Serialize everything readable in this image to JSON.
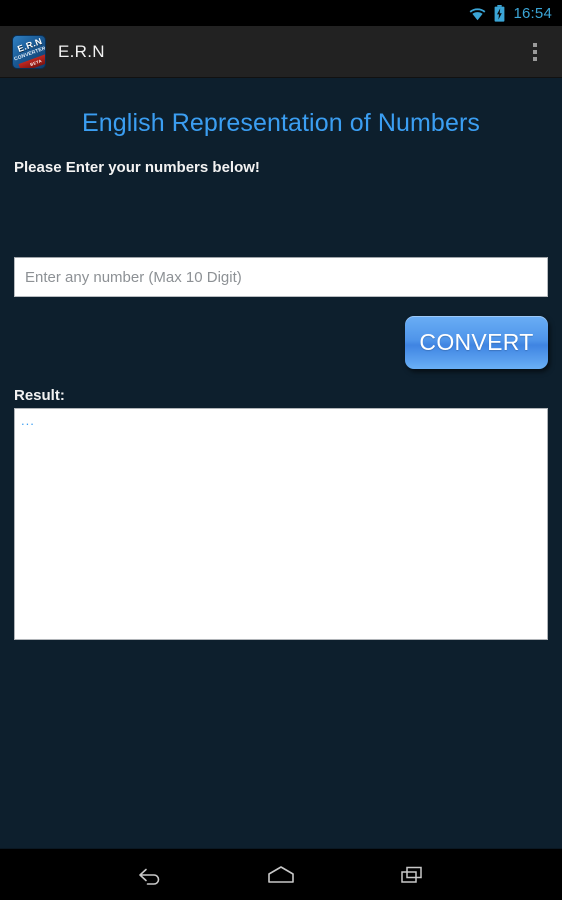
{
  "status_bar": {
    "time": "16:54",
    "icons": [
      "wifi-icon",
      "battery-charging-icon"
    ],
    "accent_color": "#3ba5d6",
    "background": "#000000"
  },
  "action_bar": {
    "app_title": "E.R.N",
    "app_icon": {
      "name": "ern-converter-app-icon",
      "primary_text": "E.R.N",
      "secondary_text": "CONVERTER",
      "ribbon_text": "BETA"
    },
    "overflow_menu_label": "More options",
    "background": "#222222"
  },
  "screen": {
    "title": "English Representation of Numbers",
    "title_color": "#3b9ef2",
    "subtitle": "Please Enter your numbers below!",
    "background": "#0d1f2d"
  },
  "input": {
    "placeholder": "Enter any number (Max 10 Digit)",
    "value": ""
  },
  "convert_button": {
    "label": "CONVERT",
    "color": "#4f95ea"
  },
  "result": {
    "label": "Result:",
    "value": "...",
    "text_color": "#3b9ef2"
  },
  "nav_bar": {
    "buttons": [
      {
        "name": "back",
        "label": "Back"
      },
      {
        "name": "home",
        "label": "Home"
      },
      {
        "name": "recents",
        "label": "Recent apps"
      }
    ]
  }
}
